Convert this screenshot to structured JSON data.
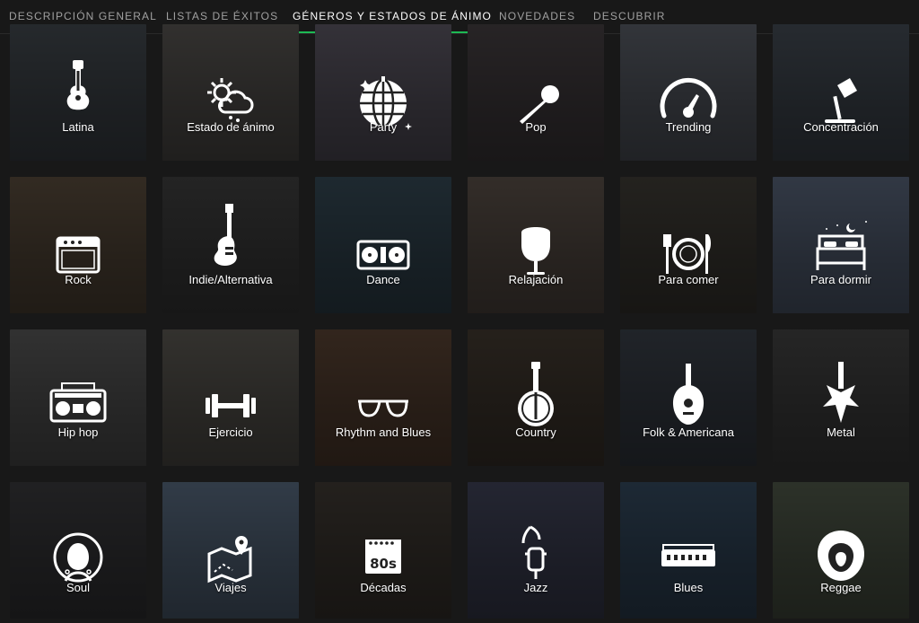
{
  "tabs": [
    {
      "label": "DESCRIPCIÓN GENERAL",
      "active": false
    },
    {
      "label": "LISTAS DE ÉXITOS",
      "active": false
    },
    {
      "label": "GÉNEROS Y ESTADOS DE ÁNIMO",
      "active": true
    },
    {
      "label": "NOVEDADES",
      "active": false
    },
    {
      "label": "DESCUBRIR",
      "active": false
    }
  ],
  "accent_color": "#1db954",
  "tiles": [
    {
      "label": "Latina",
      "icon": "guitar-icon",
      "bg": "#2c3034"
    },
    {
      "label": "Estado de ánimo",
      "icon": "weather-icon",
      "bg": "#3a3836"
    },
    {
      "label": "Party",
      "icon": "disco-ball-icon",
      "bg": "#3d3a42"
    },
    {
      "label": "Pop",
      "icon": "microphone-icon",
      "bg": "#2e2a2c"
    },
    {
      "label": "Trending",
      "icon": "speedometer-icon",
      "bg": "#3b3e44"
    },
    {
      "label": "Concentración",
      "icon": "desk-lamp-icon",
      "bg": "#2d3238"
    },
    {
      "label": "Rock",
      "icon": "amplifier-icon",
      "bg": "#3b3228"
    },
    {
      "label": "Indie/Alternativa",
      "icon": "electric-guitar-icon",
      "bg": "#2a2a2a"
    },
    {
      "label": "Dance",
      "icon": "turntable-icon",
      "bg": "#233038"
    },
    {
      "label": "Relajación",
      "icon": "armchair-icon",
      "bg": "#3c3530"
    },
    {
      "label": "Para comer",
      "icon": "plate-cutlery-icon",
      "bg": "#2a2824"
    },
    {
      "label": "Para dormir",
      "icon": "bed-icon",
      "bg": "#3a4250"
    },
    {
      "label": "Hip hop",
      "icon": "boombox-icon",
      "bg": "#3a3a3a"
    },
    {
      "label": "Ejercicio",
      "icon": "dumbbell-icon",
      "bg": "#3c3a36"
    },
    {
      "label": "Rhythm and Blues",
      "icon": "sunglasses-icon",
      "bg": "#3b2c22"
    },
    {
      "label": "Country",
      "icon": "banjo-icon",
      "bg": "#2c2620"
    },
    {
      "label": "Folk & Americana",
      "icon": "mandolin-icon",
      "bg": "#262a30"
    },
    {
      "label": "Metal",
      "icon": "metal-guitar-icon",
      "bg": "#2c2c2c"
    },
    {
      "label": "Soul",
      "icon": "afro-woman-icon",
      "bg": "#262628"
    },
    {
      "label": "Viajes",
      "icon": "map-pin-icon",
      "bg": "#3a4654"
    },
    {
      "label": "Décadas",
      "icon": "calendar-80s-icon",
      "bg": "#2a2622"
    },
    {
      "label": "Jazz",
      "icon": "trumpet-icon",
      "bg": "#2a2c3a"
    },
    {
      "label": "Blues",
      "icon": "harmonica-icon",
      "bg": "#22303e"
    },
    {
      "label": "Reggae",
      "icon": "lion-icon",
      "bg": "#343a30"
    }
  ]
}
